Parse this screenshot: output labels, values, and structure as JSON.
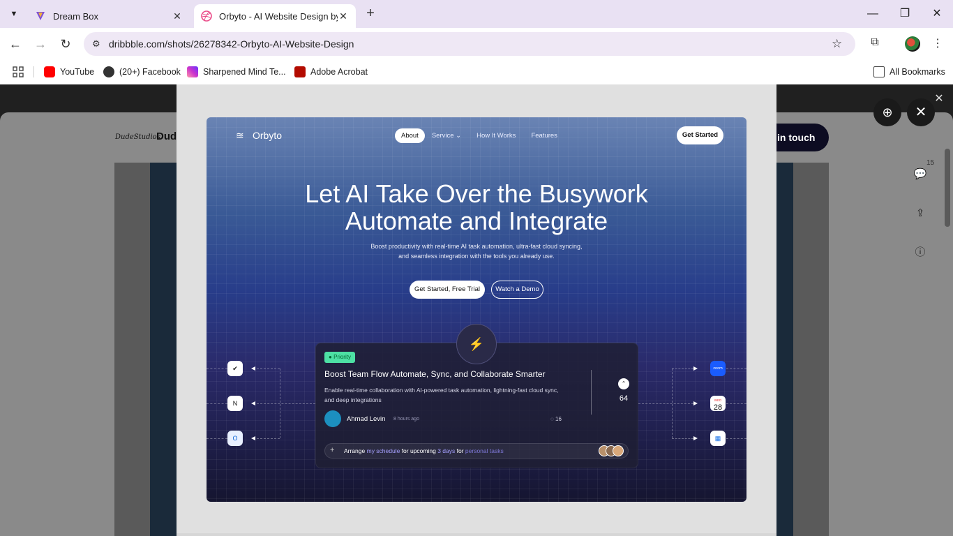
{
  "browser": {
    "tabs": [
      {
        "title": "Dream Box",
        "active": false
      },
      {
        "title": "Orbyto - AI Website Design by",
        "active": true
      }
    ],
    "url": "dribbble.com/shots/26278342-Orbyto-AI-Website-Design",
    "bookmarks": [
      "YouTube",
      "(20+) Facebook",
      "Sharpened Mind Te...",
      "Adobe Acrobat"
    ],
    "all_bookmarks": "All Bookmarks"
  },
  "background_page": {
    "brand": "DudeStudios",
    "name": "Dud",
    "get_in_touch": "in touch",
    "comments_count": "15"
  },
  "shot": {
    "logo": "Orbyto",
    "nav": [
      "About",
      "Service",
      "How It Works",
      "Features"
    ],
    "nav_cta": "Get Started",
    "headline_line1": "Let AI Take Over the Busywork",
    "headline_line2": "Automate and Integrate",
    "sub_line1": "Boost productivity with real-time AI task automation, ultra-fast cloud syncing,",
    "sub_line2": "and seamless integration with the tools you already use.",
    "btn_primary": "Get Started, Free Trial",
    "btn_secondary": "Watch a Demo",
    "card": {
      "badge": "Priority",
      "title": "Boost Team Flow Automate, Sync, and Collaborate Smarter",
      "desc": "Enable real-time collaboration with AI-powered task automation, lightning-fast cloud sync, and deep integrations",
      "author": "Ahmad Levin",
      "time": "8 hours ago",
      "comments": "16",
      "votes": "64",
      "prompt_parts": [
        "Arrange ",
        "my schedule",
        " for upcoming ",
        "3 days",
        " for ",
        "personal tasks"
      ]
    },
    "apps_right": {
      "zoom": "zoom",
      "calendar_month": "WED",
      "calendar_day": "28"
    }
  }
}
